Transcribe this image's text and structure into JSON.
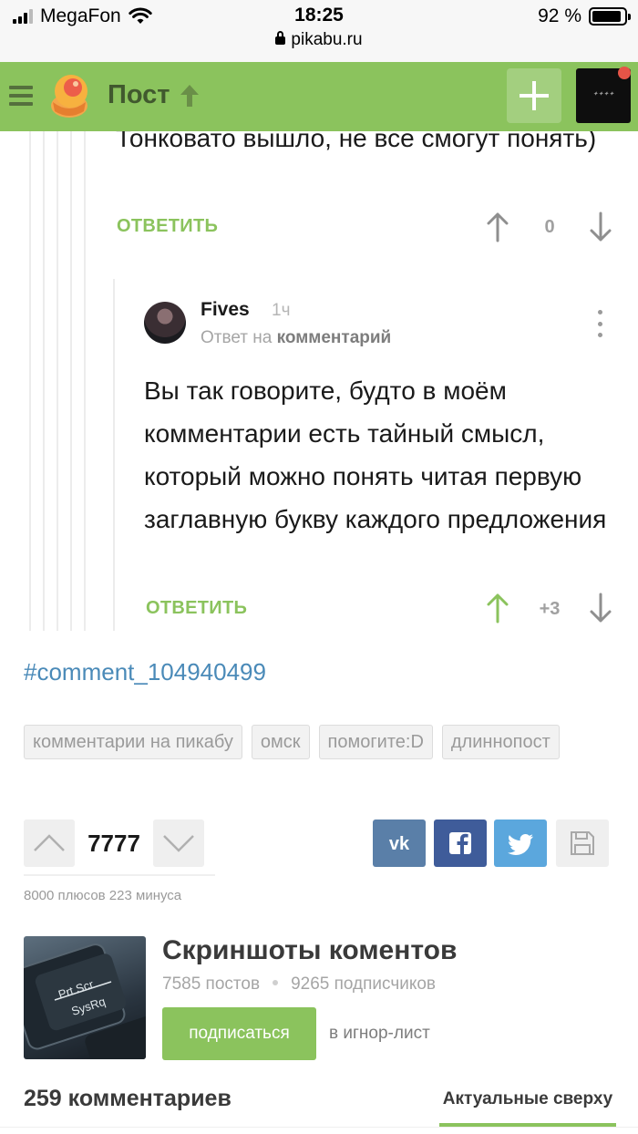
{
  "status_bar": {
    "carrier": "MegaFon",
    "time": "18:25",
    "url": "pikabu.ru",
    "battery": "92 %",
    "battery_level": 0.92
  },
  "header": {
    "title": "Пост",
    "accent_color": "#8bc35d"
  },
  "comments": [
    {
      "text": "Тонковато вышло, не все смогут понять)",
      "reply_label": "ОТВЕТИТЬ",
      "rating": "0"
    },
    {
      "author": "Fives",
      "time": "1ч",
      "reply_to_prefix": "Ответ на",
      "reply_to_target": "комментарий",
      "text": "Вы так говорите, будто в моём комментарии есть тайный смысл, который можно понять читая первую заглавную букву каждого предложения",
      "reply_label": "ОТВЕТИТЬ",
      "rating": "+3"
    }
  ],
  "permalink": "#comment_104940499",
  "tags": [
    "комментарии на пикабу",
    "омск",
    "помогите:D",
    "длиннопост"
  ],
  "post_rating": {
    "value": "7777",
    "stats": "8000 плюсов 223 минуса"
  },
  "share": {
    "vk": "vk-icon",
    "facebook": "facebook-icon",
    "twitter": "twitter-icon",
    "save": "save-icon",
    "vk_color": "#5a7fa8",
    "facebook_color": "#3f5c9a",
    "twitter_color": "#5ba7dd"
  },
  "community": {
    "name": "Скриншоты коментов",
    "posts": "7585 постов",
    "subscribers": "9265 подписчиков",
    "subscribe_label": "подписаться",
    "ignore_label": "в игнор-лист",
    "image_keys": [
      "Prt Scr",
      "SysRq"
    ]
  },
  "comments_section": {
    "count": "259 комментариев",
    "sort": "Актуальные сверху"
  }
}
